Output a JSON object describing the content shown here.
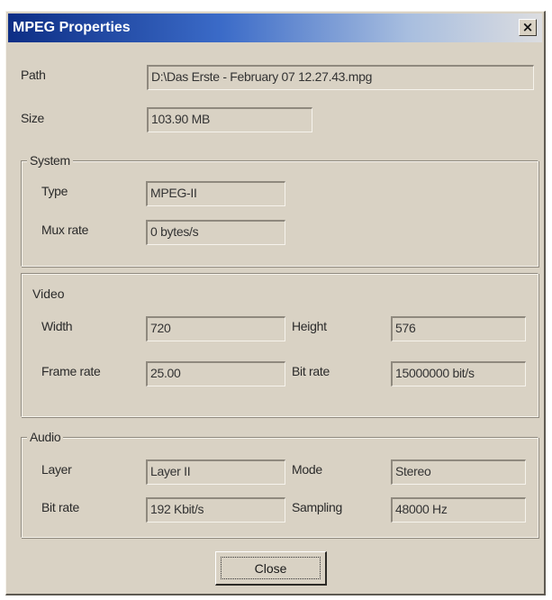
{
  "window": {
    "title": "MPEG Properties",
    "close_glyph": "×"
  },
  "file": {
    "path_label": "Path",
    "path_value": "D:\\Das Erste - February 07 12.27.43.mpg",
    "size_label": "Size",
    "size_value": "103.90 MB"
  },
  "system": {
    "title": "System",
    "type_label": "Type",
    "type_value": "MPEG-II",
    "mux_label": "Mux rate",
    "mux_value": "0 bytes/s"
  },
  "video": {
    "title": "Video",
    "width_label": "Width",
    "width_value": "720",
    "height_label": "Height",
    "height_value": "576",
    "framerate_label": "Frame rate",
    "framerate_value": "25.00",
    "bitrate_label": "Bit rate",
    "bitrate_value": "15000000 bit/s"
  },
  "audio": {
    "title": "Audio",
    "layer_label": "Layer",
    "layer_value": "Layer II",
    "mode_label": "Mode",
    "mode_value": "Stereo",
    "bitrate_label": "Bit rate",
    "bitrate_value": "192 Kbit/s",
    "sampling_label": "Sampling",
    "sampling_value": "48000 Hz"
  },
  "buttons": {
    "close_label": "Close"
  },
  "colors": {
    "dialog_bg": "#d9d2c4",
    "titlebar_start": "#0d2e85",
    "titlebar_end": "#dcdde0"
  }
}
